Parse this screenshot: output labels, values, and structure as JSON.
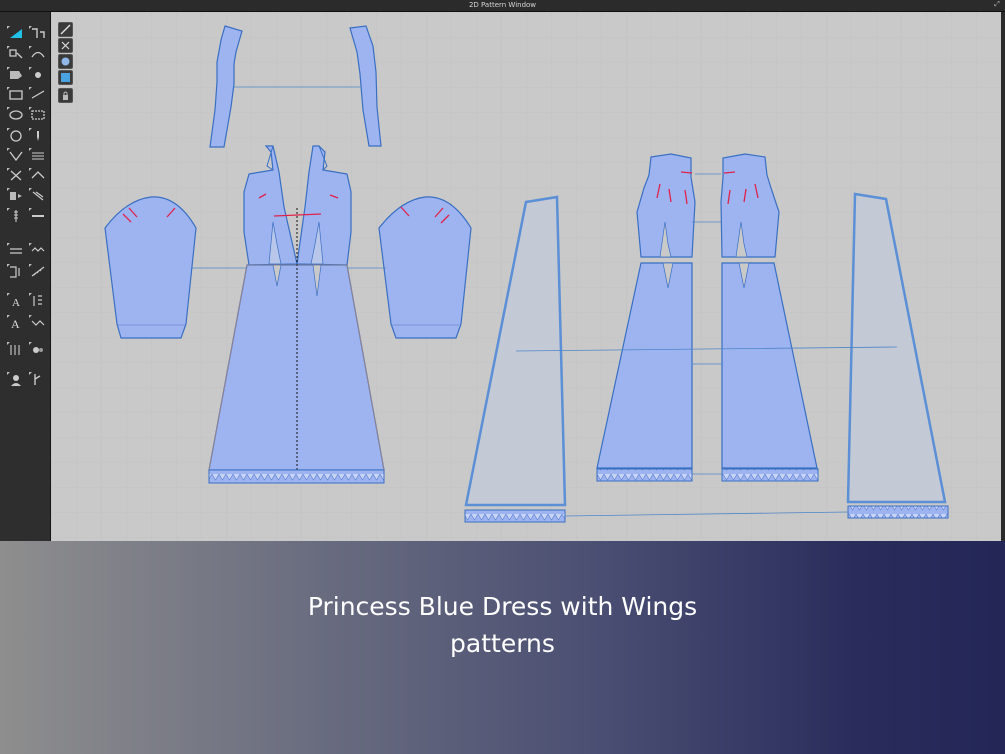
{
  "window": {
    "title": "2D Pattern Window"
  },
  "caption": {
    "line1": "Princess Blue Dress with Wings",
    "line2": "patterns"
  },
  "colors": {
    "fabric": "#9db4f0",
    "fabric_stroke": "#3a6fc2",
    "wing_fill": "#c4c9d6",
    "wing_stroke": "#5b8fd6",
    "canvas": "#c9c9c9",
    "dart": "#e0224a",
    "toolbar": "#2e2e2e",
    "accent": "#21c1e8"
  },
  "toolbar": {
    "tools": [
      "edit-pattern-icon",
      "edit-sewing-icon",
      "transform-icon",
      "edit-curve-icon",
      "polygon-icon",
      "point-icon",
      "rectangle-icon",
      "internal-line-icon",
      "ellipse-icon",
      "seam-allowance-icon",
      "circle-icon",
      "pin-icon",
      "dart-icon",
      "pleat-icon",
      "fold-icon",
      "fold-arrangement-icon",
      "sewing-icon",
      "segment-sewing-icon",
      "zipper-icon",
      "trim-icon",
      "tack-icon",
      "elastic-icon",
      "measure-icon",
      "ruler-icon",
      "text-icon",
      "annotation-icon",
      "text-style-icon",
      "graphic-icon",
      "grid-icon",
      "button-icon",
      "avatar-icon",
      "lock-icon"
    ]
  },
  "canvas_tools": [
    "select-mesh-icon",
    "arrange-icon",
    "fabric-icon",
    "texture-icon",
    "lock-icon"
  ]
}
